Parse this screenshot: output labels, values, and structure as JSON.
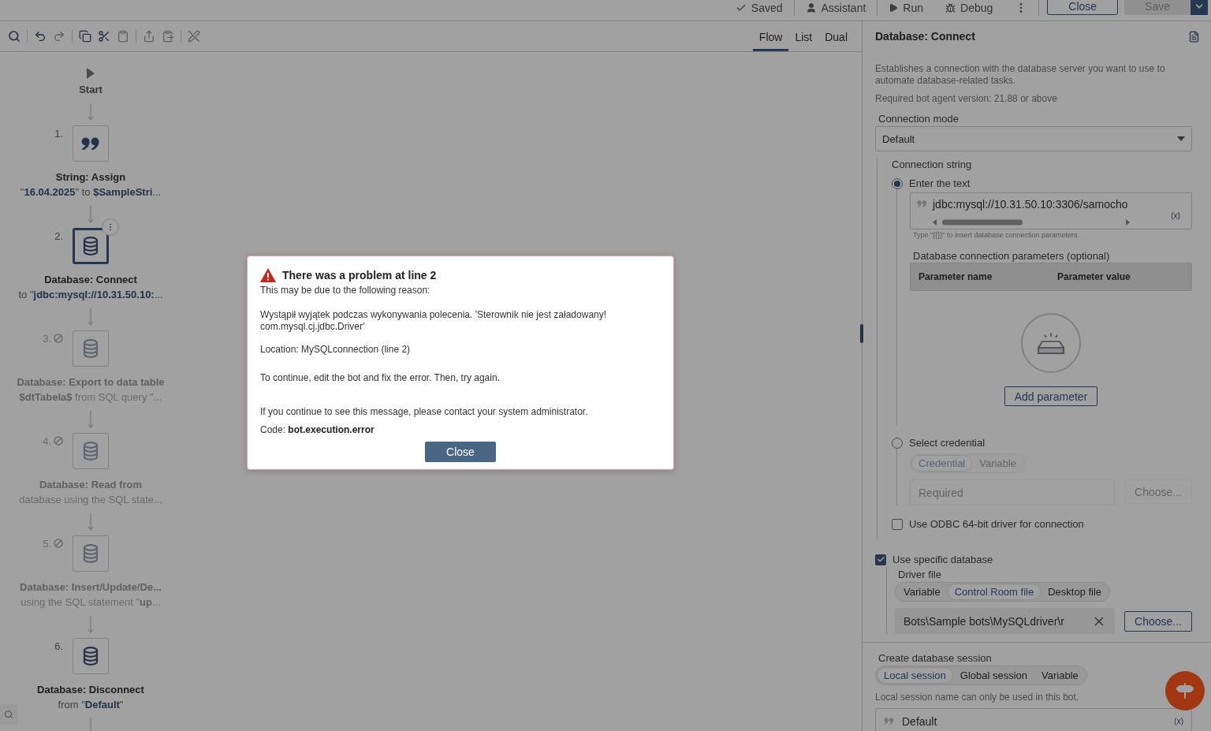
{
  "top_bar": {
    "status": "Saved",
    "actions": [
      {
        "kind": "assistant",
        "label": "Assistant"
      },
      {
        "kind": "run",
        "label": "Run"
      },
      {
        "kind": "debug",
        "label": "Debug"
      }
    ],
    "close_button": "Close",
    "save_button": {
      "label": "Save",
      "disabled": true
    }
  },
  "toolbar": {
    "view_tabs": [
      {
        "label": "Flow",
        "selected": true
      },
      {
        "label": "List",
        "selected": false
      },
      {
        "label": "Dual",
        "selected": false
      }
    ]
  },
  "flow": {
    "start": "Start",
    "nodes": [
      {
        "number": "1.",
        "kind": "quote",
        "title": "String: Assign",
        "subtitle": "\"**16.04.2025**\" to **$SampleStri**...",
        "disabled": false,
        "selected": false
      },
      {
        "number": "2.",
        "kind": "database",
        "title": "Database: Connect",
        "subtitle": "to \"**jdbc:mysql://10.31.50.10:**...",
        "disabled": false,
        "selected": true
      },
      {
        "number": "3.",
        "kind": "database",
        "title": "Database: Export to data table",
        "subtitle": "**$dtTabela$** from SQL query \"...",
        "disabled": true,
        "selected": false
      },
      {
        "number": "4.",
        "kind": "database",
        "title": "Database: Read from",
        "subtitle": "database using the SQL state...",
        "disabled": true,
        "selected": false
      },
      {
        "number": "5.",
        "kind": "database",
        "title": "Database: Insert/Update/De...",
        "subtitle": "using the SQL statement \"**up**...",
        "disabled": true,
        "selected": false
      },
      {
        "number": "6.",
        "kind": "database",
        "title": "Database: Disconnect",
        "subtitle": "from \"**Default**\"",
        "disabled": false,
        "selected": false
      }
    ]
  },
  "panel": {
    "title": "Database: Connect",
    "description": "Establishes a connection with the database server you want to use to automate database-related tasks.",
    "requirement": "Required bot agent version: 21.88 or above",
    "connection_mode": {
      "label": "Connection mode",
      "value": "Default"
    },
    "connection_string": {
      "label": "Connection string",
      "options": [
        {
          "label": "Enter the text",
          "selected": true
        },
        {
          "label": "Select credential",
          "selected": false
        }
      ],
      "text_value": "jdbc:mysql://10.31.50.10:3306/samocho",
      "variable_button": "(x)",
      "hint": "Type \"{{}}\" to insert database connection parameters.",
      "params_label": "Database connection parameters (optional)",
      "params_columns": [
        "Parameter name",
        "Parameter value"
      ],
      "add_button": "Add parameter",
      "credential": {
        "disabled": true,
        "tabs": [
          {
            "label": "Credential",
            "selected": true
          },
          {
            "label": "Variable",
            "selected": false
          }
        ],
        "placeholder": "Required",
        "choose_button": "Choose..."
      }
    },
    "odbc": {
      "label": "Use ODBC 64-bit driver for connection",
      "checked": false
    },
    "specific_db": {
      "label": "Use specific database",
      "checked": true,
      "driver_label": "Driver file",
      "driver_tabs": [
        {
          "label": "Variable",
          "selected": false
        },
        {
          "label": "Control Room file",
          "selected": true
        },
        {
          "label": "Desktop file",
          "selected": false
        }
      ],
      "driver_value": "Bots\\Sample bots\\MySQLdriver\\r",
      "choose_button": "Choose..."
    },
    "session": {
      "label": "Create database session",
      "tabs": [
        {
          "label": "Local session",
          "selected": true
        },
        {
          "label": "Global session",
          "selected": false
        },
        {
          "label": "Variable",
          "selected": false
        }
      ],
      "hint": "Local session name can only be used in this bot.",
      "value": "Default",
      "variable_button": "(x)"
    }
  },
  "dialog": {
    "title": "There was a problem at line 2",
    "intro": "This may be due to the following reason:",
    "message": "Wystąpił wyjątek podczas wykonywania polecenia. 'Sterownik nie jest załadowany!\ncom.mysql.cj.jdbc.Driver'",
    "location": "Location: MySQLconnection (line 2)",
    "instruction": "To continue, edit the bot and fix the error. Then, try again.",
    "contact": "If you continue to see this message, please contact your system administrator.",
    "code": "Code: **bot.execution.error**",
    "button": "Close"
  }
}
